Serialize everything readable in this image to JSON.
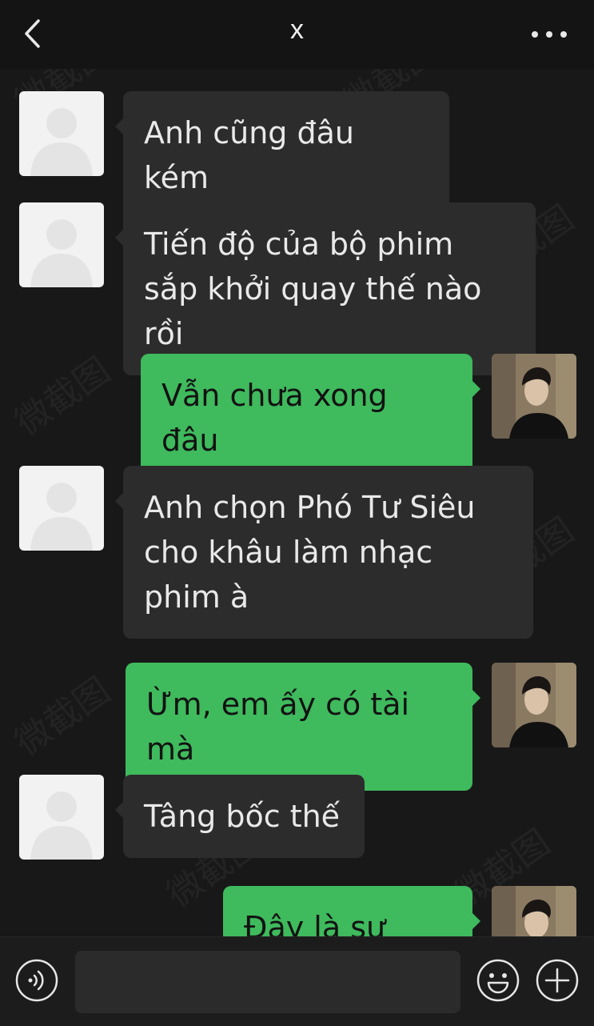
{
  "header": {
    "title": "x",
    "back_icon": "chevron-left-icon",
    "more_icon": "more-dots-icon"
  },
  "messages": [
    {
      "side": "in",
      "text": "Anh cũng đâu kém"
    },
    {
      "side": "in",
      "text": "Tiến độ của bộ phim sắp khởi quay thế nào rồi"
    },
    {
      "side": "out",
      "text": "Vẫn chưa xong đâu"
    },
    {
      "side": "in",
      "text": "Anh chọn Phó Tư Siêu cho khâu làm nhạc phim à"
    },
    {
      "side": "out",
      "text": "Ừm, em ấy có tài mà"
    },
    {
      "side": "in",
      "text": "Tâng bốc thế"
    },
    {
      "side": "out",
      "text": "Đây là sự thật"
    }
  ],
  "input": {
    "value": "",
    "placeholder": ""
  },
  "toolbar": {
    "voice_icon": "voice-icon",
    "emoji_icon": "emoji-icon",
    "plus_icon": "plus-icon"
  },
  "colors": {
    "background": "#181818",
    "incoming_bubble": "#2c2c2c",
    "outgoing_bubble": "#3fba5d"
  }
}
